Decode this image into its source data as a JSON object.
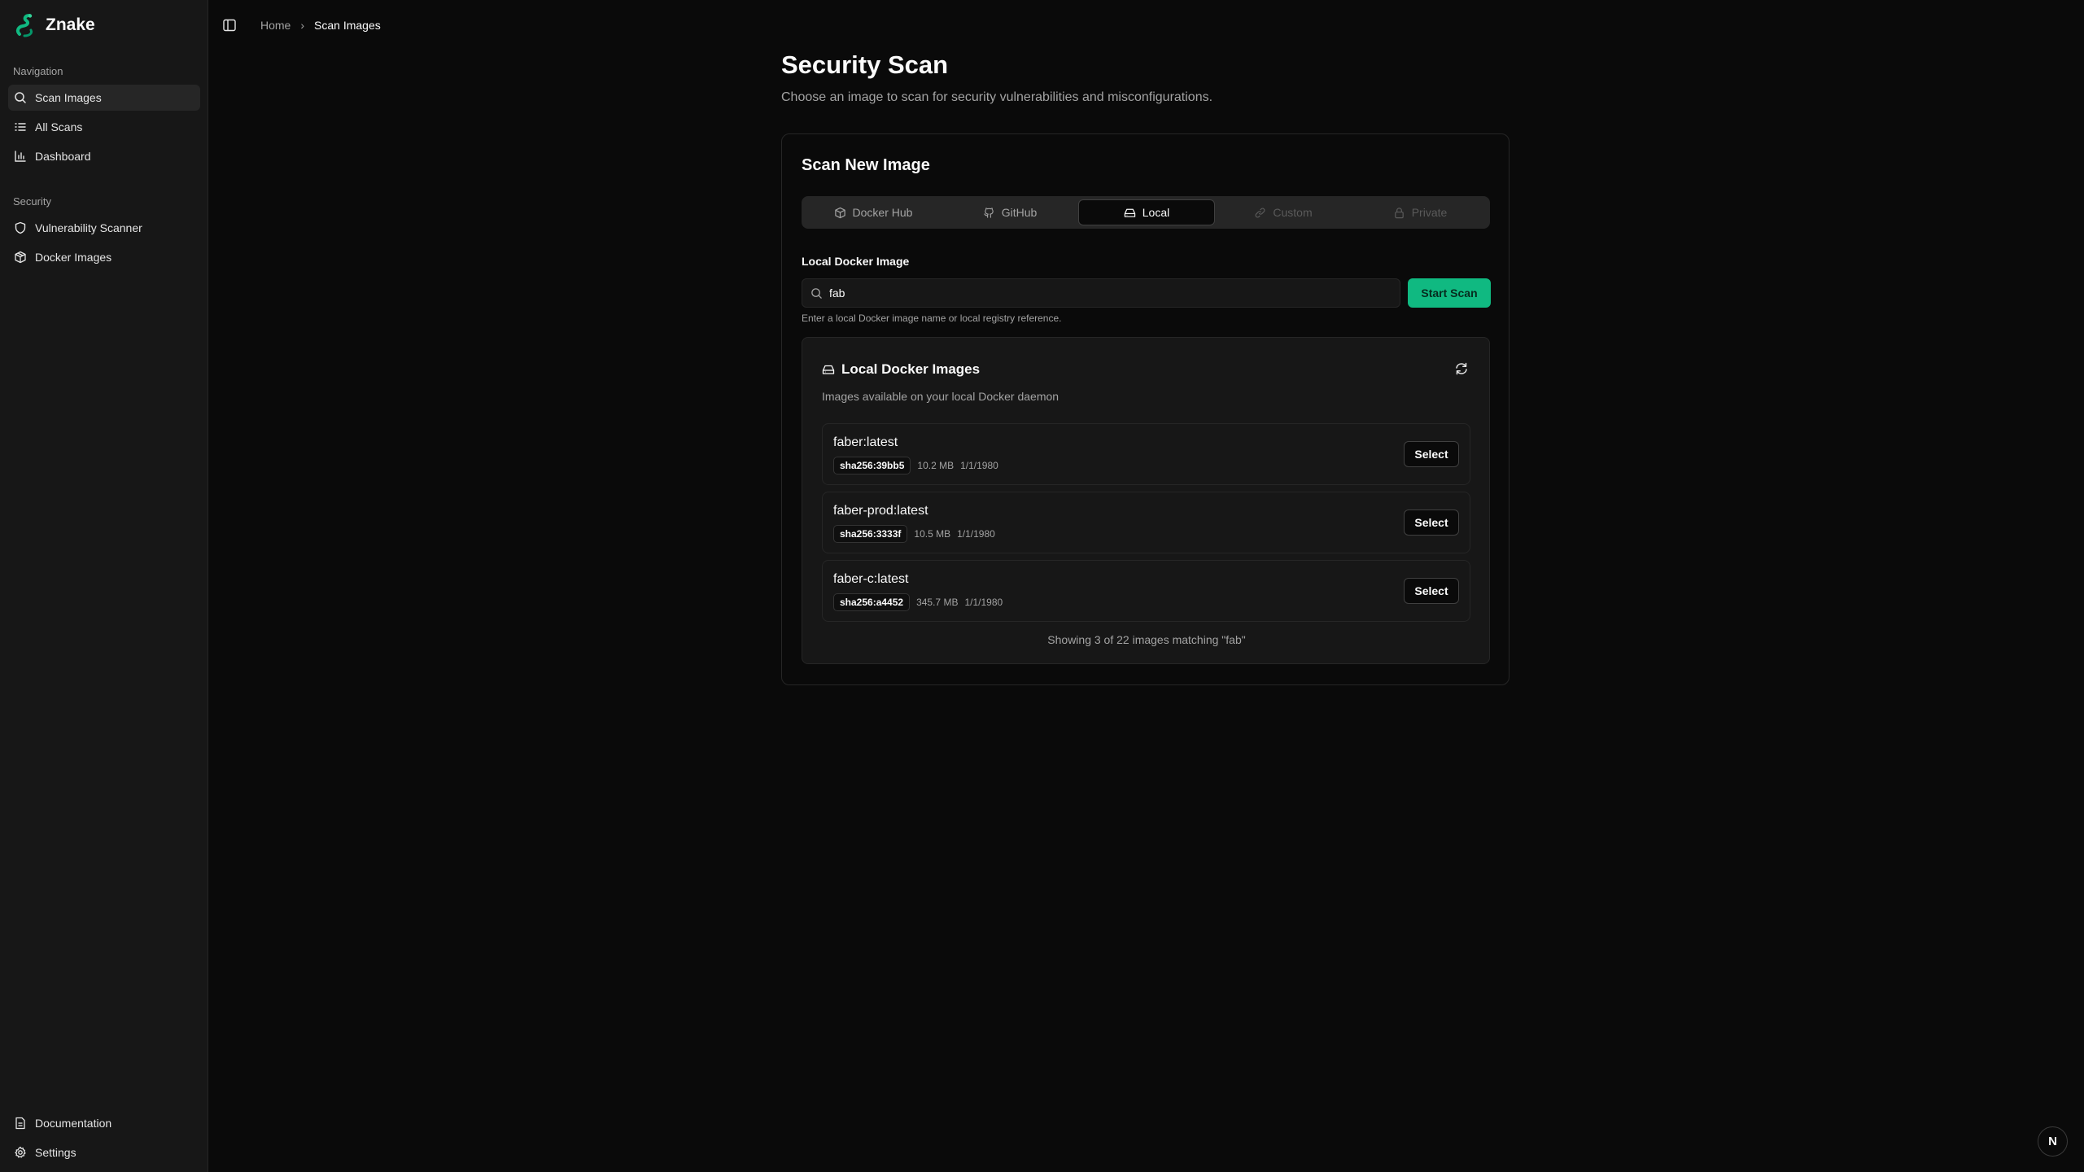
{
  "app": {
    "name": "Znake"
  },
  "sidebar": {
    "navigation_label": "Navigation",
    "security_label": "Security",
    "items": [
      {
        "label": "Scan Images",
        "icon": "search-icon",
        "active": true
      },
      {
        "label": "All Scans",
        "icon": "list-icon"
      },
      {
        "label": "Dashboard",
        "icon": "bar-chart-icon"
      },
      {
        "label": "Vulnerability Scanner",
        "icon": "shield-icon"
      },
      {
        "label": "Docker Images",
        "icon": "package-icon"
      }
    ],
    "footer": [
      {
        "label": "Documentation",
        "icon": "document-icon"
      },
      {
        "label": "Settings",
        "icon": "gear-icon"
      }
    ]
  },
  "breadcrumb": {
    "home": "Home",
    "separator": "›",
    "current": "Scan Images"
  },
  "page": {
    "title": "Security Scan",
    "subtitle": "Choose an image to scan for security vulnerabilities and misconfigurations."
  },
  "scan": {
    "title": "Scan New Image",
    "tabs": [
      {
        "label": "Docker Hub",
        "icon": "package-icon"
      },
      {
        "label": "GitHub",
        "icon": "github-icon"
      },
      {
        "label": "Local",
        "icon": "hard-drive-icon",
        "active": true
      },
      {
        "label": "Custom",
        "icon": "link-icon",
        "disabled": true
      },
      {
        "label": "Private",
        "icon": "lock-icon",
        "disabled": true
      }
    ],
    "field_label": "Local Docker Image",
    "input_value": "fab",
    "start_button": "Start Scan",
    "hint": "Enter a local Docker image name or local registry reference."
  },
  "local_images": {
    "title": "Local Docker Images",
    "subtitle": "Images available on your local Docker daemon",
    "select_label": "Select",
    "items": [
      {
        "name": "faber:latest",
        "sha": "sha256:39bb5",
        "size": "10.2 MB",
        "date": "1/1/1980"
      },
      {
        "name": "faber-prod:latest",
        "sha": "sha256:3333f",
        "size": "10.5 MB",
        "date": "1/1/1980"
      },
      {
        "name": "faber-c:latest",
        "sha": "sha256:a4452",
        "size": "345.7 MB",
        "date": "1/1/1980"
      }
    ],
    "showing": "Showing 3 of 22 images matching \"fab\""
  },
  "badge": {
    "label": "N"
  },
  "colors": {
    "accent": "#10b981",
    "background": "#0a0a0a",
    "sidebar": "#171717"
  }
}
